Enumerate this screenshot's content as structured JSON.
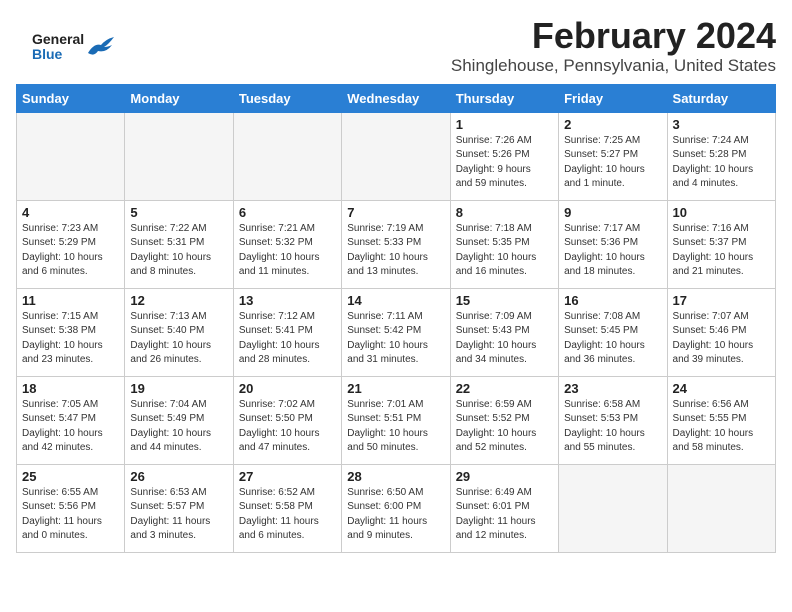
{
  "logo": {
    "general": "General",
    "blue": "Blue"
  },
  "header": {
    "month_year": "February 2024",
    "location": "Shinglehouse, Pennsylvania, United States"
  },
  "days_of_week": [
    "Sunday",
    "Monday",
    "Tuesday",
    "Wednesday",
    "Thursday",
    "Friday",
    "Saturday"
  ],
  "weeks": [
    [
      {
        "day": "",
        "info": ""
      },
      {
        "day": "",
        "info": ""
      },
      {
        "day": "",
        "info": ""
      },
      {
        "day": "",
        "info": ""
      },
      {
        "day": "1",
        "info": "Sunrise: 7:26 AM\nSunset: 5:26 PM\nDaylight: 9 hours\nand 59 minutes."
      },
      {
        "day": "2",
        "info": "Sunrise: 7:25 AM\nSunset: 5:27 PM\nDaylight: 10 hours\nand 1 minute."
      },
      {
        "day": "3",
        "info": "Sunrise: 7:24 AM\nSunset: 5:28 PM\nDaylight: 10 hours\nand 4 minutes."
      }
    ],
    [
      {
        "day": "4",
        "info": "Sunrise: 7:23 AM\nSunset: 5:29 PM\nDaylight: 10 hours\nand 6 minutes."
      },
      {
        "day": "5",
        "info": "Sunrise: 7:22 AM\nSunset: 5:31 PM\nDaylight: 10 hours\nand 8 minutes."
      },
      {
        "day": "6",
        "info": "Sunrise: 7:21 AM\nSunset: 5:32 PM\nDaylight: 10 hours\nand 11 minutes."
      },
      {
        "day": "7",
        "info": "Sunrise: 7:19 AM\nSunset: 5:33 PM\nDaylight: 10 hours\nand 13 minutes."
      },
      {
        "day": "8",
        "info": "Sunrise: 7:18 AM\nSunset: 5:35 PM\nDaylight: 10 hours\nand 16 minutes."
      },
      {
        "day": "9",
        "info": "Sunrise: 7:17 AM\nSunset: 5:36 PM\nDaylight: 10 hours\nand 18 minutes."
      },
      {
        "day": "10",
        "info": "Sunrise: 7:16 AM\nSunset: 5:37 PM\nDaylight: 10 hours\nand 21 minutes."
      }
    ],
    [
      {
        "day": "11",
        "info": "Sunrise: 7:15 AM\nSunset: 5:38 PM\nDaylight: 10 hours\nand 23 minutes."
      },
      {
        "day": "12",
        "info": "Sunrise: 7:13 AM\nSunset: 5:40 PM\nDaylight: 10 hours\nand 26 minutes."
      },
      {
        "day": "13",
        "info": "Sunrise: 7:12 AM\nSunset: 5:41 PM\nDaylight: 10 hours\nand 28 minutes."
      },
      {
        "day": "14",
        "info": "Sunrise: 7:11 AM\nSunset: 5:42 PM\nDaylight: 10 hours\nand 31 minutes."
      },
      {
        "day": "15",
        "info": "Sunrise: 7:09 AM\nSunset: 5:43 PM\nDaylight: 10 hours\nand 34 minutes."
      },
      {
        "day": "16",
        "info": "Sunrise: 7:08 AM\nSunset: 5:45 PM\nDaylight: 10 hours\nand 36 minutes."
      },
      {
        "day": "17",
        "info": "Sunrise: 7:07 AM\nSunset: 5:46 PM\nDaylight: 10 hours\nand 39 minutes."
      }
    ],
    [
      {
        "day": "18",
        "info": "Sunrise: 7:05 AM\nSunset: 5:47 PM\nDaylight: 10 hours\nand 42 minutes."
      },
      {
        "day": "19",
        "info": "Sunrise: 7:04 AM\nSunset: 5:49 PM\nDaylight: 10 hours\nand 44 minutes."
      },
      {
        "day": "20",
        "info": "Sunrise: 7:02 AM\nSunset: 5:50 PM\nDaylight: 10 hours\nand 47 minutes."
      },
      {
        "day": "21",
        "info": "Sunrise: 7:01 AM\nSunset: 5:51 PM\nDaylight: 10 hours\nand 50 minutes."
      },
      {
        "day": "22",
        "info": "Sunrise: 6:59 AM\nSunset: 5:52 PM\nDaylight: 10 hours\nand 52 minutes."
      },
      {
        "day": "23",
        "info": "Sunrise: 6:58 AM\nSunset: 5:53 PM\nDaylight: 10 hours\nand 55 minutes."
      },
      {
        "day": "24",
        "info": "Sunrise: 6:56 AM\nSunset: 5:55 PM\nDaylight: 10 hours\nand 58 minutes."
      }
    ],
    [
      {
        "day": "25",
        "info": "Sunrise: 6:55 AM\nSunset: 5:56 PM\nDaylight: 11 hours\nand 0 minutes."
      },
      {
        "day": "26",
        "info": "Sunrise: 6:53 AM\nSunset: 5:57 PM\nDaylight: 11 hours\nand 3 minutes."
      },
      {
        "day": "27",
        "info": "Sunrise: 6:52 AM\nSunset: 5:58 PM\nDaylight: 11 hours\nand 6 minutes."
      },
      {
        "day": "28",
        "info": "Sunrise: 6:50 AM\nSunset: 6:00 PM\nDaylight: 11 hours\nand 9 minutes."
      },
      {
        "day": "29",
        "info": "Sunrise: 6:49 AM\nSunset: 6:01 PM\nDaylight: 11 hours\nand 12 minutes."
      },
      {
        "day": "",
        "info": ""
      },
      {
        "day": "",
        "info": ""
      }
    ]
  ]
}
